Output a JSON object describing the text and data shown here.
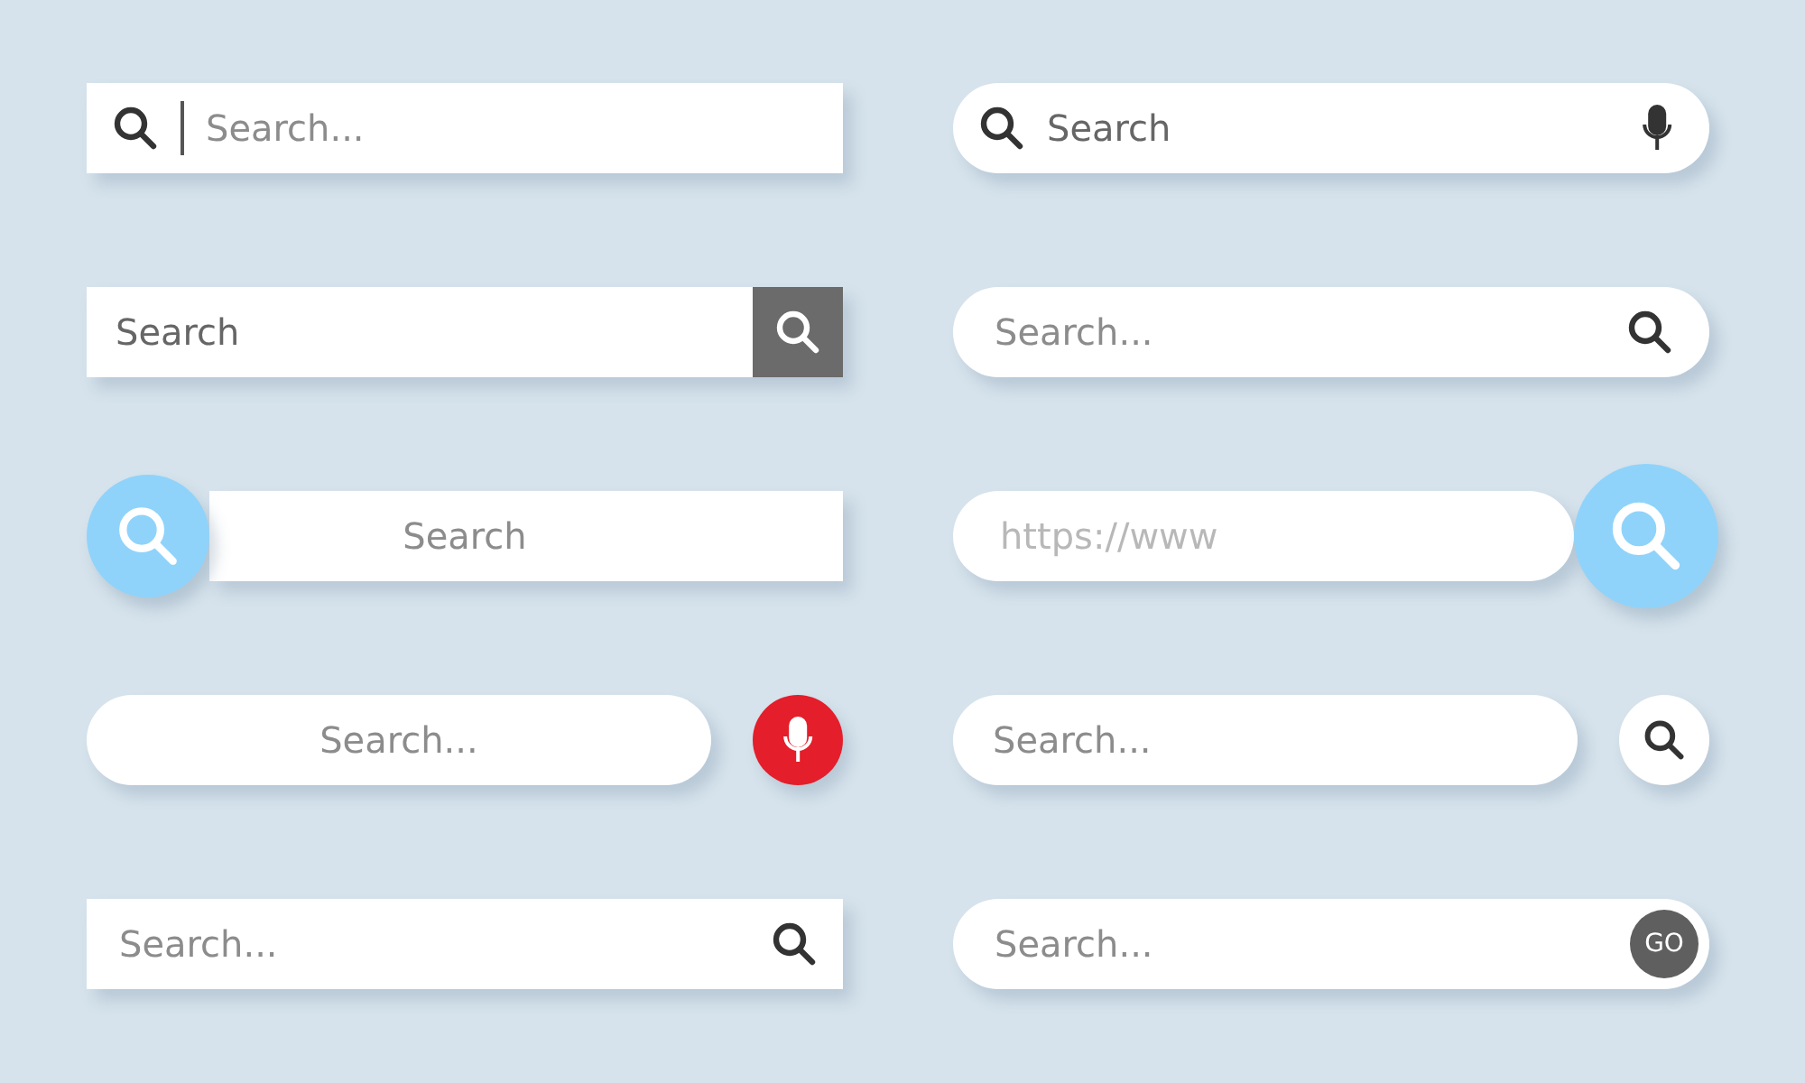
{
  "search_bars": [
    {
      "kind": "cursor",
      "placeholder": "Search..."
    },
    {
      "kind": "mic",
      "value": "Search"
    },
    {
      "kind": "square-button",
      "value": "Search"
    },
    {
      "kind": "icon-right-pill",
      "placeholder": "Search..."
    },
    {
      "kind": "circle-left",
      "placeholder": "Search"
    },
    {
      "kind": "circle-right",
      "placeholder": "https://www"
    },
    {
      "kind": "mic-apart",
      "placeholder": "Search..."
    },
    {
      "kind": "search-apart",
      "placeholder": "Search..."
    },
    {
      "kind": "icon-right",
      "placeholder": "Search..."
    },
    {
      "kind": "go",
      "placeholder": "Search...",
      "button_label": "GO"
    }
  ]
}
